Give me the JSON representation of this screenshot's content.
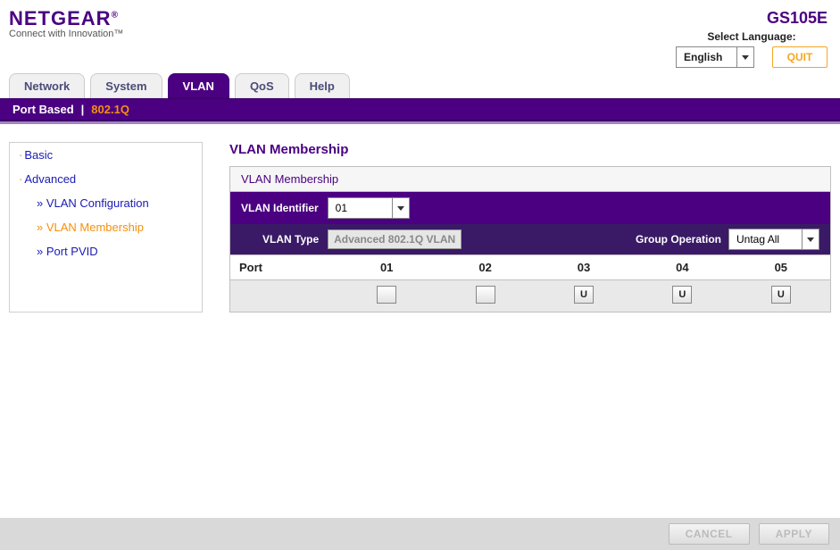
{
  "brand": {
    "name": "NETGEAR",
    "reg": "®",
    "tagline": "Connect with Innovation™"
  },
  "model": "GS105E",
  "language": {
    "label": "Select Language:",
    "value": "English"
  },
  "quit": "QUIT",
  "tabs": [
    "Network",
    "System",
    "VLAN",
    "QoS",
    "Help"
  ],
  "active_tab": "VLAN",
  "subnav": {
    "port_based": "Port Based",
    "active": "802.1Q"
  },
  "sidenav": {
    "basic": "Basic",
    "advanced": "Advanced",
    "items": [
      {
        "label": "VLAN Configuration",
        "active": false
      },
      {
        "label": "VLAN Membership",
        "active": true
      },
      {
        "label": "Port PVID",
        "active": false
      }
    ]
  },
  "page": {
    "title": "VLAN Membership",
    "panel_title": "VLAN Membership",
    "vlan_id_label": "VLAN Identifier",
    "vlan_id_value": "01",
    "vlan_type_label": "VLAN Type",
    "vlan_type_value": "Advanced 802.1Q VLAN",
    "group_op_label": "Group Operation",
    "group_op_value": "Untag All",
    "port_label": "Port",
    "ports": [
      "01",
      "02",
      "03",
      "04",
      "05"
    ],
    "membership": [
      "",
      "",
      "U",
      "U",
      "U"
    ]
  },
  "footer": {
    "cancel": "CANCEL",
    "apply": "APPLY"
  }
}
